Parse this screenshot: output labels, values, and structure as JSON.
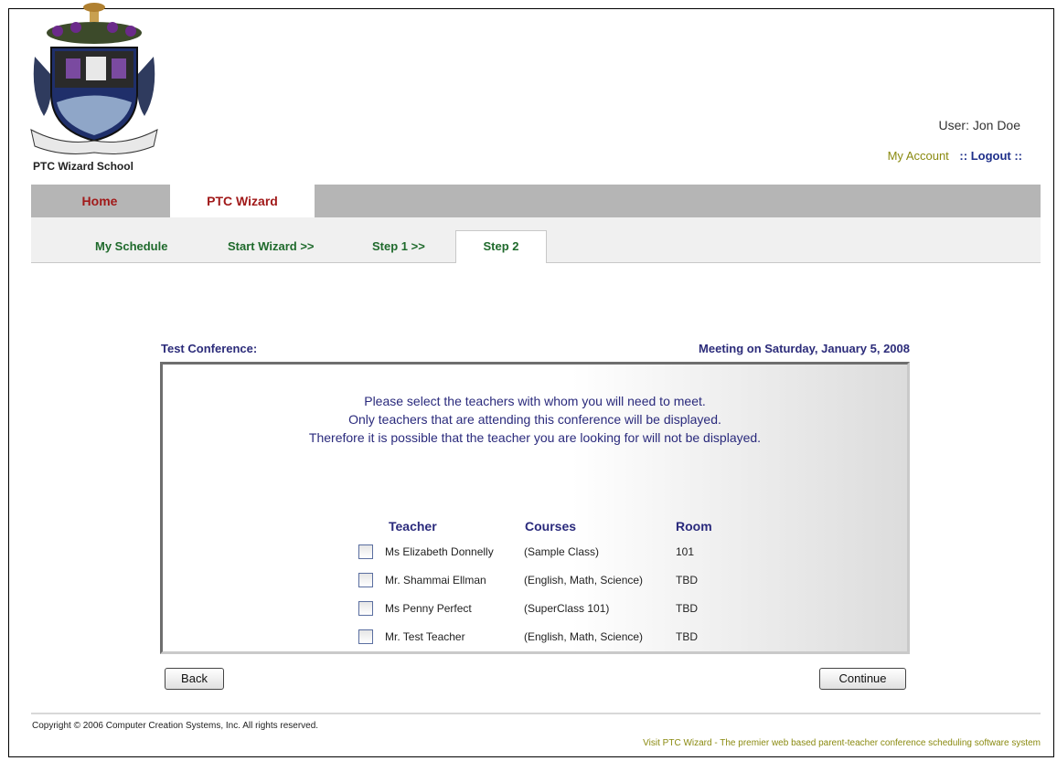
{
  "header": {
    "school_name": "PTC Wizard School",
    "user_label": "User: Jon Doe",
    "my_account": "My Account",
    "logout": ":: Logout ::"
  },
  "main_tabs": [
    {
      "label": "Home",
      "active": false
    },
    {
      "label": "PTC Wizard",
      "active": true
    }
  ],
  "sub_tabs": [
    {
      "label": "My Schedule"
    },
    {
      "label": "Start Wizard >>"
    },
    {
      "label": "Step 1 >>"
    },
    {
      "label": "Step 2",
      "active": true
    }
  ],
  "conference": {
    "title": "Test Conference:",
    "meeting": "Meeting on Saturday, January 5, 2008"
  },
  "instructions": [
    "Please select the teachers with whom you will need to meet.",
    "Only teachers that are attending this conference will be displayed.",
    "Therefore it is possible that the teacher you are looking for will not be displayed."
  ],
  "table": {
    "headers": {
      "teacher": "Teacher",
      "courses": "Courses",
      "room": "Room"
    },
    "rows": [
      {
        "teacher": "Ms Elizabeth Donnelly",
        "courses": "(Sample Class)",
        "room": "101",
        "checked": false
      },
      {
        "teacher": "Mr. Shammai Ellman",
        "courses": "(English, Math, Science)",
        "room": "TBD",
        "checked": false
      },
      {
        "teacher": "Ms Penny Perfect",
        "courses": "(SuperClass 101)",
        "room": "TBD",
        "checked": false
      },
      {
        "teacher": "Mr. Test Teacher",
        "courses": "(English, Math, Science)",
        "room": "TBD",
        "checked": false
      }
    ]
  },
  "buttons": {
    "back": "Back",
    "continue": "Continue"
  },
  "footer": {
    "copyright": "Copyright © 2006 Computer Creation Systems, Inc. All rights reserved.",
    "link": "Visit PTC Wizard - The premier web based parent-teacher conference scheduling software system"
  },
  "colors": {
    "tab_red": "#a11a1a",
    "subtab_green": "#1f6a2c",
    "text_navy": "#2a2a7c",
    "olive_link": "#8a8a10"
  }
}
